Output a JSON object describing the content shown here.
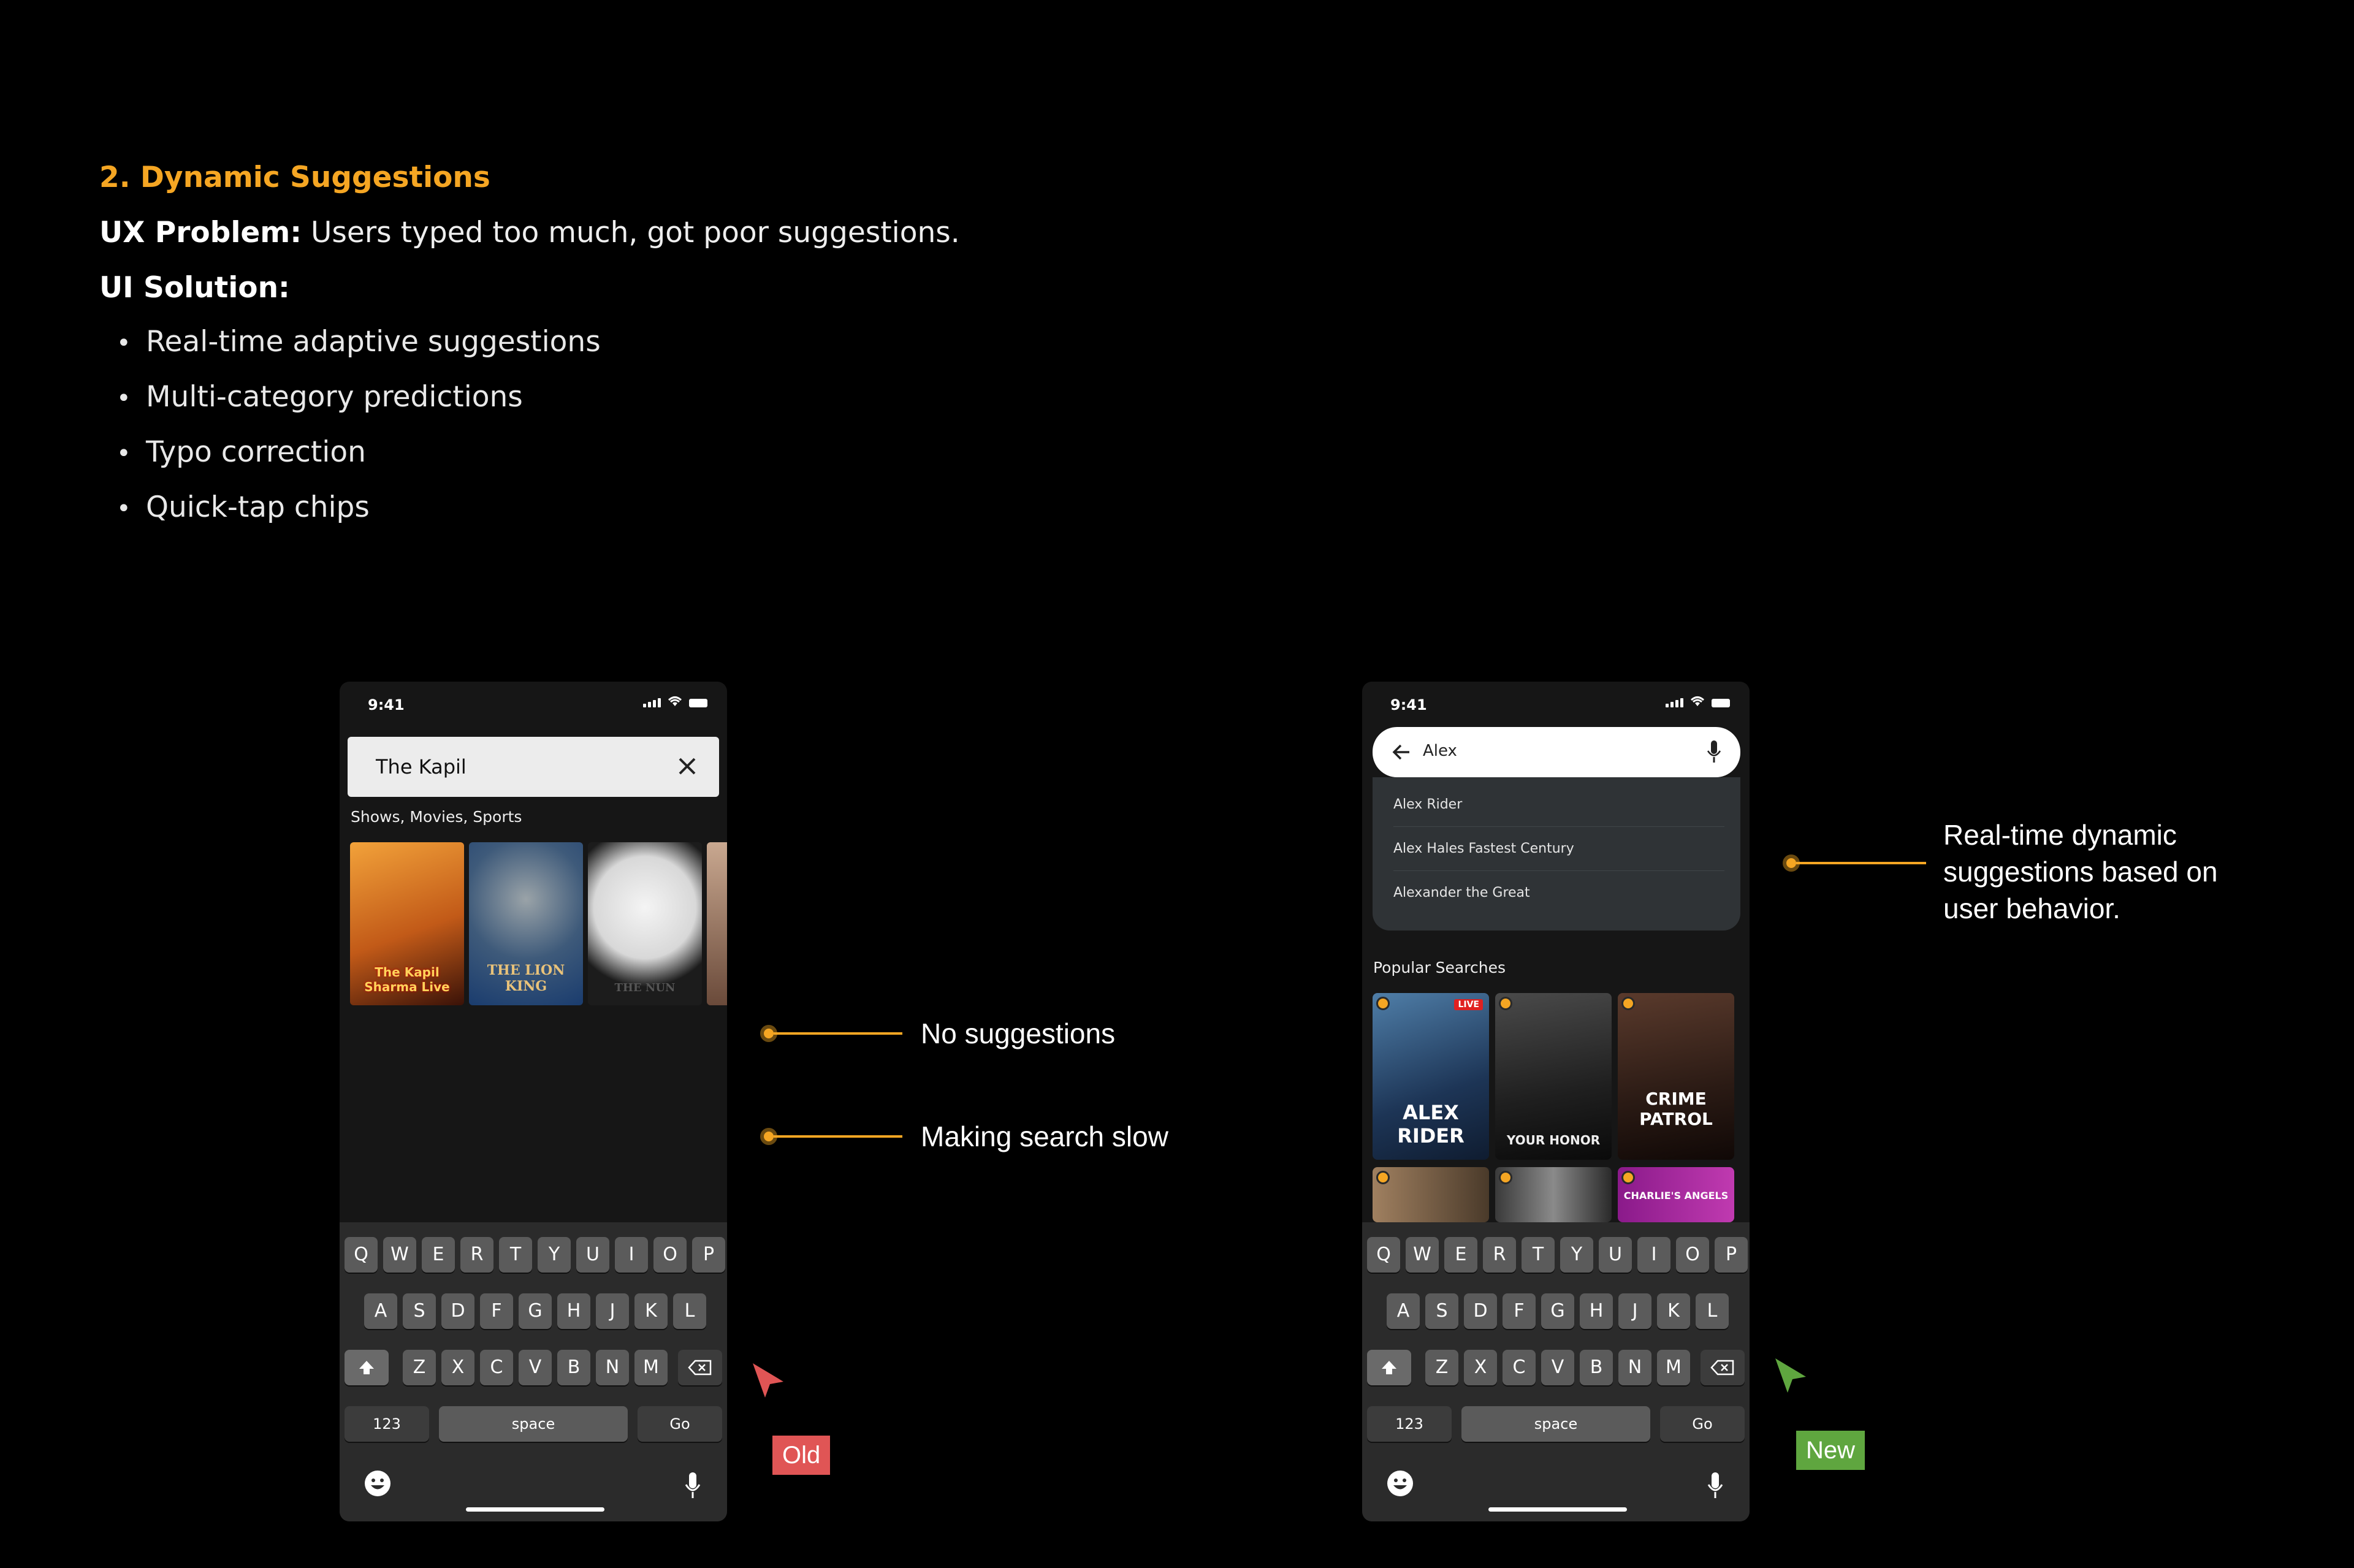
{
  "header": {
    "title": "2. Dynamic Suggestions",
    "ux_problem_label": "UX Problem:",
    "ux_problem_text": " Users typed too much, got poor suggestions.",
    "ui_solution_label": "UI Solution:",
    "bullets": [
      "Real-time adaptive suggestions",
      "Multi-category predictions",
      "Typo correction",
      "Quick-tap chips"
    ]
  },
  "colors": {
    "accent": "#f5a623",
    "old_badge": "#e05555",
    "new_badge": "#5fa63f"
  },
  "old_phone": {
    "time": "9:41",
    "search_value": "The Kapil",
    "category_label": "Shows, Movies, Sports",
    "posters": [
      "The Kapil Sharma Live",
      "THE LION KING",
      "THE NUN"
    ],
    "badge": "Old"
  },
  "new_phone": {
    "time": "9:41",
    "search_value": "Alex",
    "suggestions": [
      "Alex Rider",
      "Alex Hales Fastest Century",
      "Alexander the Great"
    ],
    "popular_label": "Popular Searches",
    "tiles": [
      "ALEX RIDER",
      "YOUR HONOR",
      "CRIME PATROL",
      "",
      "",
      "CHARLIE'S ANGELS"
    ],
    "live_badge": "LIVE",
    "badge": "New"
  },
  "keyboard": {
    "row1": [
      "Q",
      "W",
      "E",
      "R",
      "T",
      "Y",
      "U",
      "I",
      "O",
      "P"
    ],
    "row2": [
      "A",
      "S",
      "D",
      "F",
      "G",
      "H",
      "J",
      "K",
      "L"
    ],
    "row3": [
      "Z",
      "X",
      "C",
      "V",
      "B",
      "N",
      "M"
    ],
    "numbers": "123",
    "space": "space",
    "go": "Go"
  },
  "annotations": {
    "no_suggestions": "No suggestions",
    "making_slow": "Making search slow",
    "realtime_1": "Real-time dynamic",
    "realtime_2": "suggestions based on",
    "realtime_3": "user behavior."
  }
}
